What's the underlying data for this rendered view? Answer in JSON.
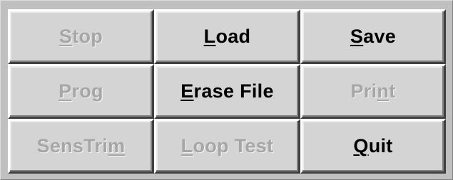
{
  "colors": {
    "panel_bg": "#c0c0c0",
    "button_face": "#d4d4d4",
    "enabled_text": "#000000",
    "disabled_text": "#a6a6a6"
  },
  "buttons": [
    {
      "id": "stop",
      "pre": "",
      "mnemonic": "S",
      "post": "top",
      "enabled": false
    },
    {
      "id": "load",
      "pre": "",
      "mnemonic": "L",
      "post": "oad",
      "enabled": true
    },
    {
      "id": "save",
      "pre": "",
      "mnemonic": "S",
      "post": "ave",
      "enabled": true
    },
    {
      "id": "prog",
      "pre": "",
      "mnemonic": "P",
      "post": "rog",
      "enabled": false
    },
    {
      "id": "erase-file",
      "pre": "",
      "mnemonic": "E",
      "post": "rase File",
      "enabled": true
    },
    {
      "id": "print",
      "pre": "Pri",
      "mnemonic": "n",
      "post": "t",
      "enabled": false
    },
    {
      "id": "senstrim",
      "pre": "SensTri",
      "mnemonic": "m",
      "post": "",
      "enabled": false
    },
    {
      "id": "loop-test",
      "pre": "",
      "mnemonic": "L",
      "post": "oop Test",
      "enabled": false
    },
    {
      "id": "quit",
      "pre": "",
      "mnemonic": "Q",
      "post": "uit",
      "enabled": true
    }
  ]
}
